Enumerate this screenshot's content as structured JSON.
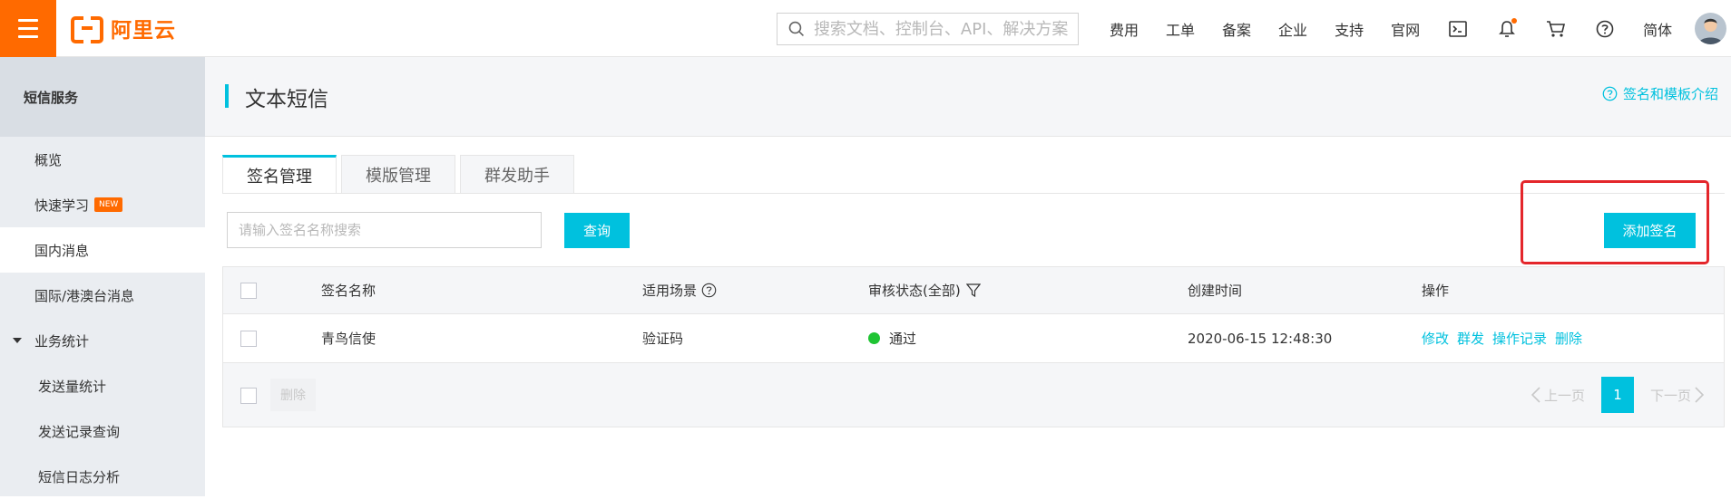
{
  "topbar": {
    "logo_text": "阿里云",
    "search_placeholder": "搜索文档、控制台、API、解决方案",
    "nav_items": [
      "费用",
      "工单",
      "备案",
      "企业",
      "支持",
      "官网"
    ],
    "language": "简体",
    "brand_color": "#ff6a00"
  },
  "sidebar": {
    "title": "短信服务",
    "items": [
      {
        "label": "概览"
      },
      {
        "label": "快速学习",
        "badge": "NEW"
      },
      {
        "label": "国内消息"
      },
      {
        "label": "国际/港澳台消息"
      },
      {
        "label": "业务统计"
      },
      {
        "label": "发送量统计"
      },
      {
        "label": "发送记录查询"
      },
      {
        "label": "短信日志分析"
      }
    ]
  },
  "page": {
    "title": "文本短信",
    "help_link": "签名和模板介绍",
    "accent_color": "#00c1de"
  },
  "tabs": [
    {
      "label": "签名管理"
    },
    {
      "label": "模版管理"
    },
    {
      "label": "群发助手"
    }
  ],
  "toolbar": {
    "search_placeholder": "请输入签名名称搜索",
    "query_button": "查询",
    "add_button": "添加签名"
  },
  "table": {
    "headers": {
      "name": "签名名称",
      "scene": "适用场景",
      "status": "审核状态(全部)",
      "created": "创建时间",
      "actions": "操作"
    },
    "rows": [
      {
        "name": "青鸟信使",
        "scene": "验证码",
        "status": "通过",
        "created": "2020-06-15 12:48:30",
        "actions": [
          "修改",
          "群发",
          "操作记录",
          "删除"
        ]
      }
    ]
  },
  "footer": {
    "delete_button": "删除",
    "prev": "上一页",
    "current_page": "1",
    "next": "下一页"
  }
}
